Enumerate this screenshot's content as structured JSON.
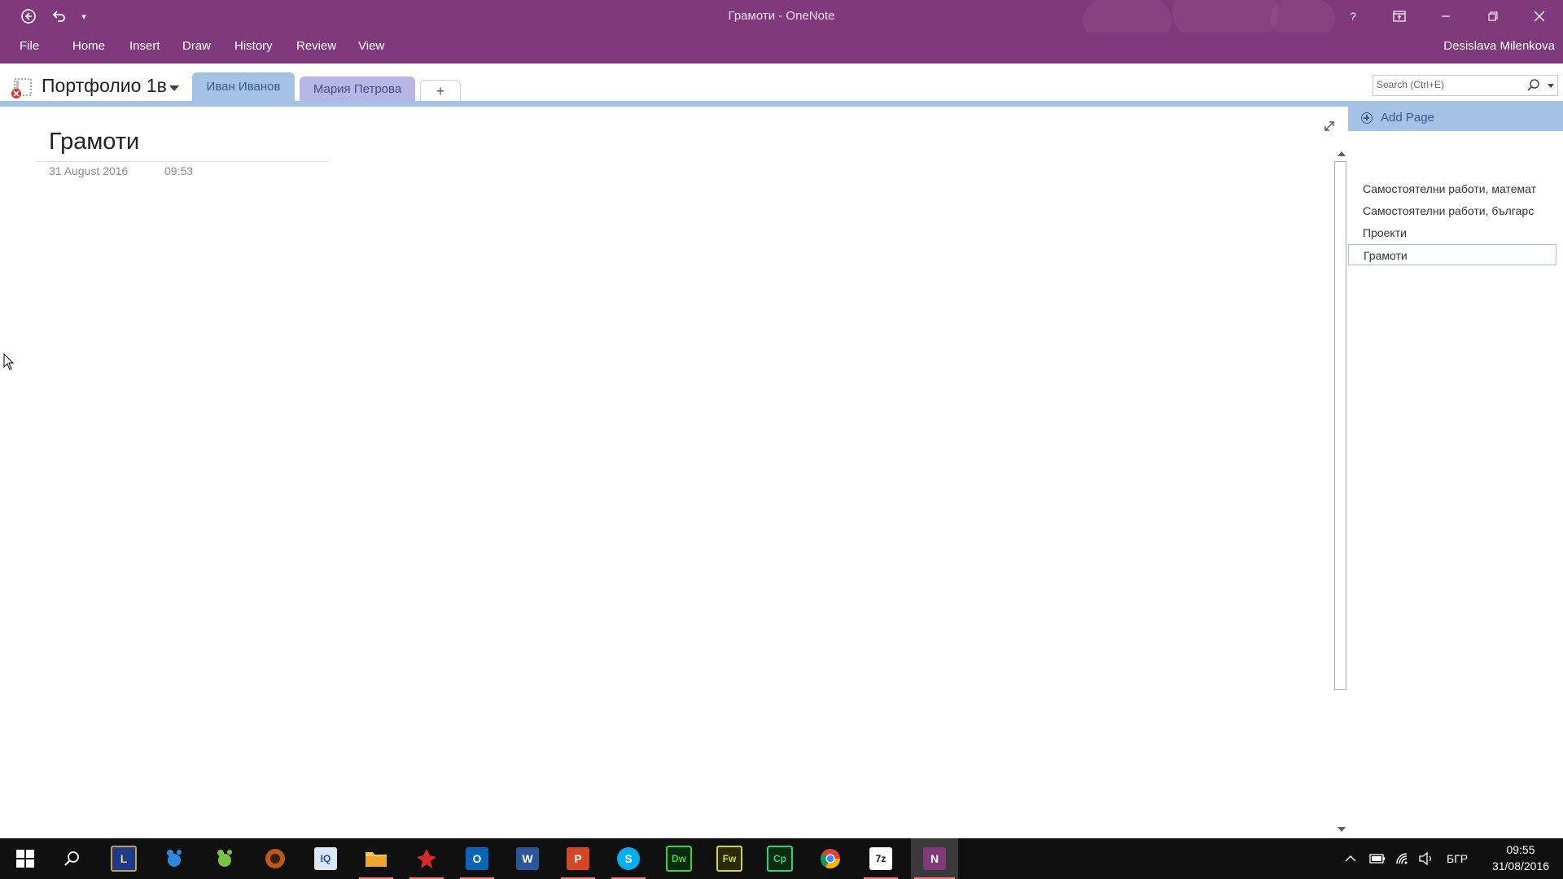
{
  "window": {
    "title": "Грамоти - OneNote",
    "user": "Desislava Milenkova",
    "help": "?"
  },
  "ribbon": {
    "tabs": [
      "File",
      "Home",
      "Insert",
      "Draw",
      "History",
      "Review",
      "View"
    ]
  },
  "notebook": {
    "name": "Портфолио 1в",
    "sections": [
      "Иван Иванов",
      "Мария Петрова"
    ],
    "add_section": "+",
    "active_section": "Иван Иванов"
  },
  "search": {
    "placeholder": "Search (Ctrl+E)"
  },
  "page": {
    "title": "Грамоти",
    "date": "31 August 2016",
    "time": "09:53"
  },
  "pages_pane": {
    "add_page": "Add Page",
    "pages": [
      "Самостоятелни работи, математ",
      "Самостоятелни работи, българс",
      "Проекти",
      "Грамоти"
    ],
    "selected": "Грамоти"
  },
  "taskbar": {
    "apps": [
      "start-icon",
      "search-icon",
      "league-icon",
      "bird-icon",
      "smiley-icon",
      "game-icon",
      "iq-icon",
      "file-explorer-icon",
      "bird-red-icon",
      "outlook-icon",
      "word-icon",
      "powerpoint-icon",
      "skype-icon",
      "dreamweaver-icon",
      "fireworks-icon",
      "captivate-icon",
      "chrome-icon",
      "7zip-icon",
      "onenote-icon"
    ],
    "labels": {
      "iq": "IQ",
      "outlook": "O",
      "word": "W",
      "powerpoint": "P",
      "skype": "S",
      "dreamweaver": "Dw",
      "fireworks": "Fw",
      "captivate": "Cp",
      "sevenzip": "7z",
      "onenote": "N"
    },
    "language": "БГР",
    "time": "09:55",
    "date": "31/08/2016"
  },
  "colors": {
    "onenote_purple": "#80397b",
    "section_blue": "#a4c2e6",
    "section_lavender": "#b7b6e6"
  }
}
